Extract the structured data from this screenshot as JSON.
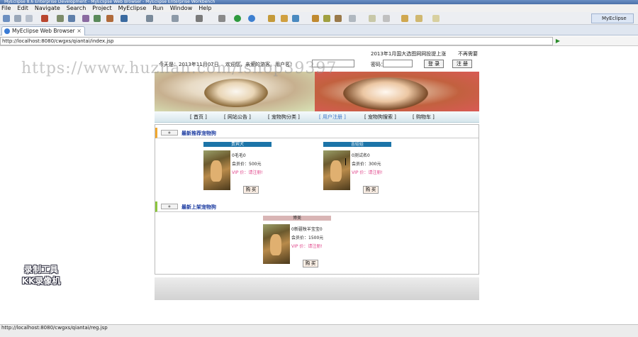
{
  "window": {
    "title": "MyEclipse 8.6 Enterprise Development - MyEclipse Web Browser - MyEclipse Enterprise Workbench"
  },
  "menu": [
    "File",
    "Edit",
    "Navigate",
    "Search",
    "Project",
    "MyEclipse",
    "Run",
    "Window",
    "Help"
  ],
  "perspective": {
    "label": "MyEclipse J..."
  },
  "tab": {
    "label": "MyEclipse Web Browser",
    "close": "×"
  },
  "url": {
    "value": "http://localhost:8080/cwgxs/qiantai/index.jsp"
  },
  "site": {
    "topline": {
      "date": "2013年1月国大选图网网投提上涨",
      "marquee": "不再需要"
    },
    "login": {
      "greeting": "今天是：2013年11月07日",
      "welcome": "欢迎您，亲爱的游客。用户名：",
      "password_label": "密码：",
      "login_button": "登 录",
      "register_button": "注 册"
    },
    "nav": [
      "[ 首页 ]",
      "[ 网站公告 ]",
      "[ 宠物狗分类 ]",
      "[ 用户注册 ]",
      "[ 宠物狗搜索 ]",
      "[ 购物车 ]"
    ],
    "sections": {
      "recommended": "最新推荐宠物狗",
      "newest": "最新上架宠物狗"
    },
    "cards": [
      {
        "header": "贵宾犬",
        "name": "0毛毛0",
        "price": "会员价：500元",
        "vip": "VIP 价：请注册!",
        "buy": "购 买"
      },
      {
        "header": "吉娃娃",
        "name": "0测试名0",
        "price": "会员价：300元",
        "vip": "VIP 价：请注册!",
        "buy": "购 买"
      },
      {
        "header": "博美",
        "name": "0新疆牧羊宝宝0",
        "price": "会员价：1500元",
        "vip": "VIP 价：请注册!",
        "buy": "购 买"
      }
    ]
  },
  "status": {
    "text": "http://localhost:8080/cwgxs/qiantai/reg.jsp"
  },
  "overlay": {
    "watermark": "https://www.huzhan.com/ishop39397",
    "badge_line1": "录制工具",
    "badge_line2": "KK录像机"
  },
  "colors": {
    "card_header_blue": "#1c74a8",
    "card_header_pink": "#d9b5b5",
    "vip_pink": "#e0458a",
    "section_orange": "#f0a830",
    "section_green": "#8dc63f"
  }
}
